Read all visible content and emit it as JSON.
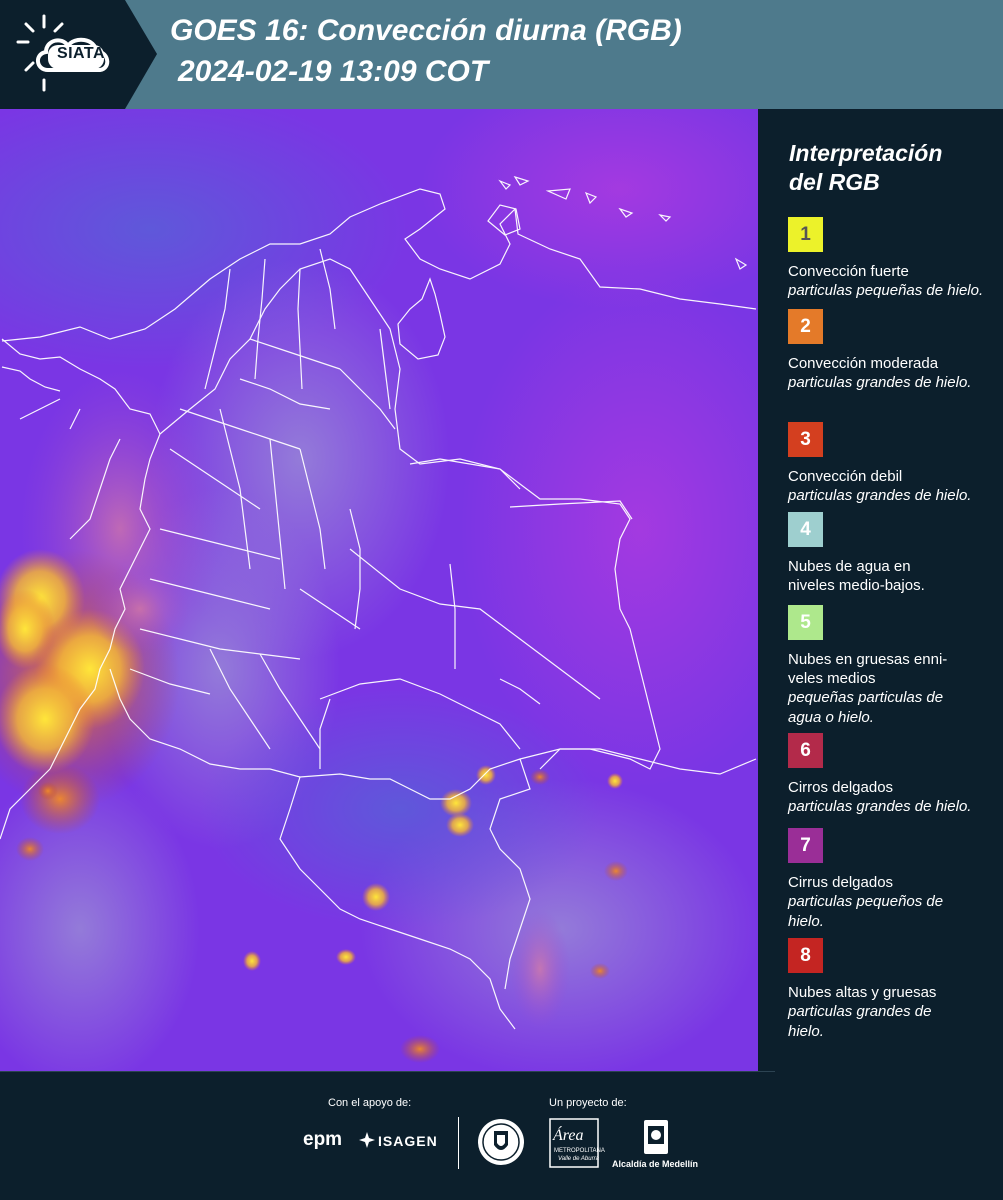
{
  "header": {
    "logo_text": "SIATA",
    "title": "GOES 16: Convección diurna (RGB)",
    "timestamp": "2024-02-19 13:09 COT"
  },
  "legend": {
    "title_line1": "Interpretación",
    "title_line2": "del RGB",
    "items": [
      {
        "number": "1",
        "color": "#ecf22a",
        "label": "Convección fuerte",
        "detail": "particulas pequeñas de hielo."
      },
      {
        "number": "2",
        "color": "#e47a29",
        "label": "Convección moderada",
        "detail": "particulas grandes de hielo."
      },
      {
        "number": "3",
        "color": "#d43f1f",
        "label": "Convección debil",
        "detail": "particulas grandes de hielo."
      },
      {
        "number": "4",
        "color": "#9ecfcf",
        "label": "Nubes de agua en niveles medio-bajos.",
        "detail": ""
      },
      {
        "number": "5",
        "color": "#aee88c",
        "label": "Nubes en gruesas enni-veles medios",
        "detail": "pequeñas particulas de agua o hielo."
      },
      {
        "number": "6",
        "color": "#b32a4a",
        "label": "Cirros delgados",
        "detail": "particulas grandes de hielo."
      },
      {
        "number": "7",
        "color": "#9a2e97",
        "label": "Cirrus delgados",
        "detail": "particulas pequeños de hielo."
      },
      {
        "number": "8",
        "color": "#c42522",
        "label": "Nubes altas y gruesas",
        "detail": "particulas grandes de hielo."
      }
    ]
  },
  "footer": {
    "support_caption": "Con el apoyo de:",
    "project_caption": "Un proyecto de:",
    "epm": "epm",
    "isagen": "ISAGEN",
    "area": "Área",
    "area_sub": "METROPOLITANA",
    "area_sub2": "Valle de Aburrá",
    "alcaldia": "Alcaldía de Medellín"
  },
  "colors": {
    "header": "#4e7a8c",
    "background": "#0c1f2c",
    "map_base": "#7a36e4"
  }
}
